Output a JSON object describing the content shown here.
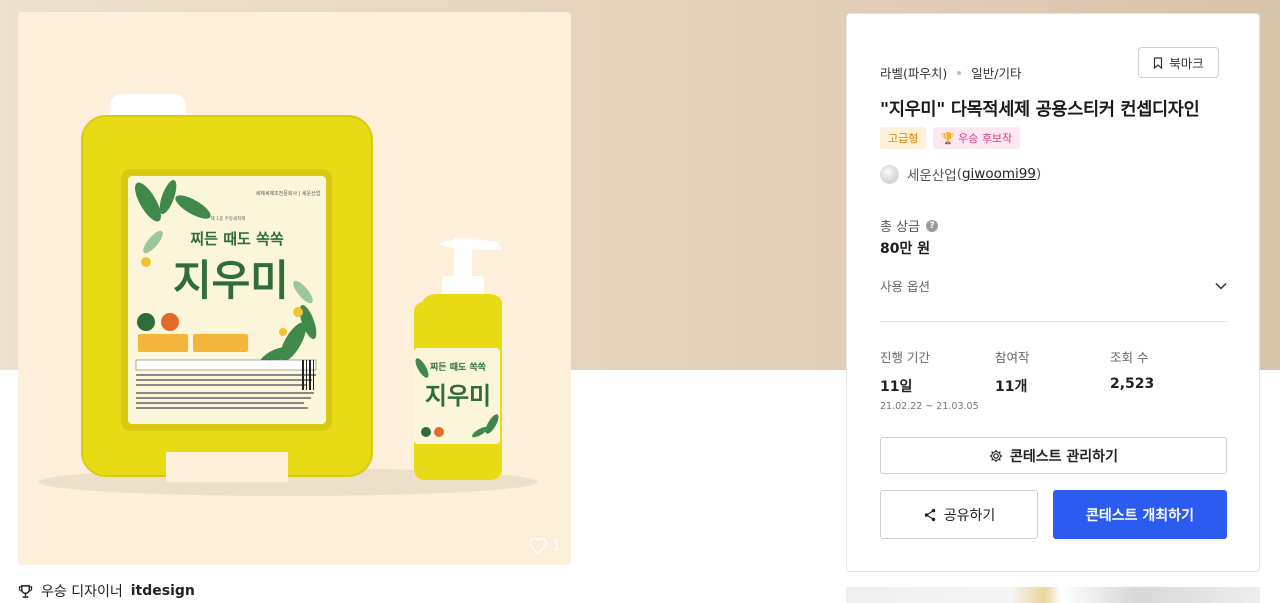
{
  "product_image": {
    "like_count": "1",
    "label": {
      "top_text": "세제세제조전문회사 | 세운산업",
      "slogan": "찌든 때도 쏙쏙",
      "brand": "지우미",
      "small_brand": "제 1종 주방세척제"
    }
  },
  "winner_line": {
    "prefix": "우승 디자이너",
    "name": "itdesign"
  },
  "panel": {
    "breadcrumb": [
      "라벨(파우치)",
      "일반/기타"
    ],
    "bookmark_label": "북마크",
    "title": "\"지우미\" 다목적세제 공용스티커 컨셉디자인",
    "badges": {
      "grade": "고급형",
      "candidate": "우승 후보작"
    },
    "designer": {
      "name": "세운산업",
      "handle": "giwoomi99"
    },
    "prize": {
      "label": "총 상금",
      "value": "80만 원"
    },
    "usage_option_label": "사용 옵션",
    "stats": {
      "period_label": "진행 기간",
      "period_value": "11일",
      "period_range": "21.02.22 ~ 21.03.05",
      "entries_label": "참여작",
      "entries_value": "11개",
      "views_label": "조회 수",
      "views_value": "2,523"
    },
    "buttons": {
      "manage": "콘테스트 관리하기",
      "share": "공유하기",
      "host": "콘테스트 개최하기"
    }
  },
  "colors": {
    "accent": "#2b5bf0",
    "grade_badge_text": "#e0860a",
    "candidate_badge_text": "#e0388a"
  }
}
